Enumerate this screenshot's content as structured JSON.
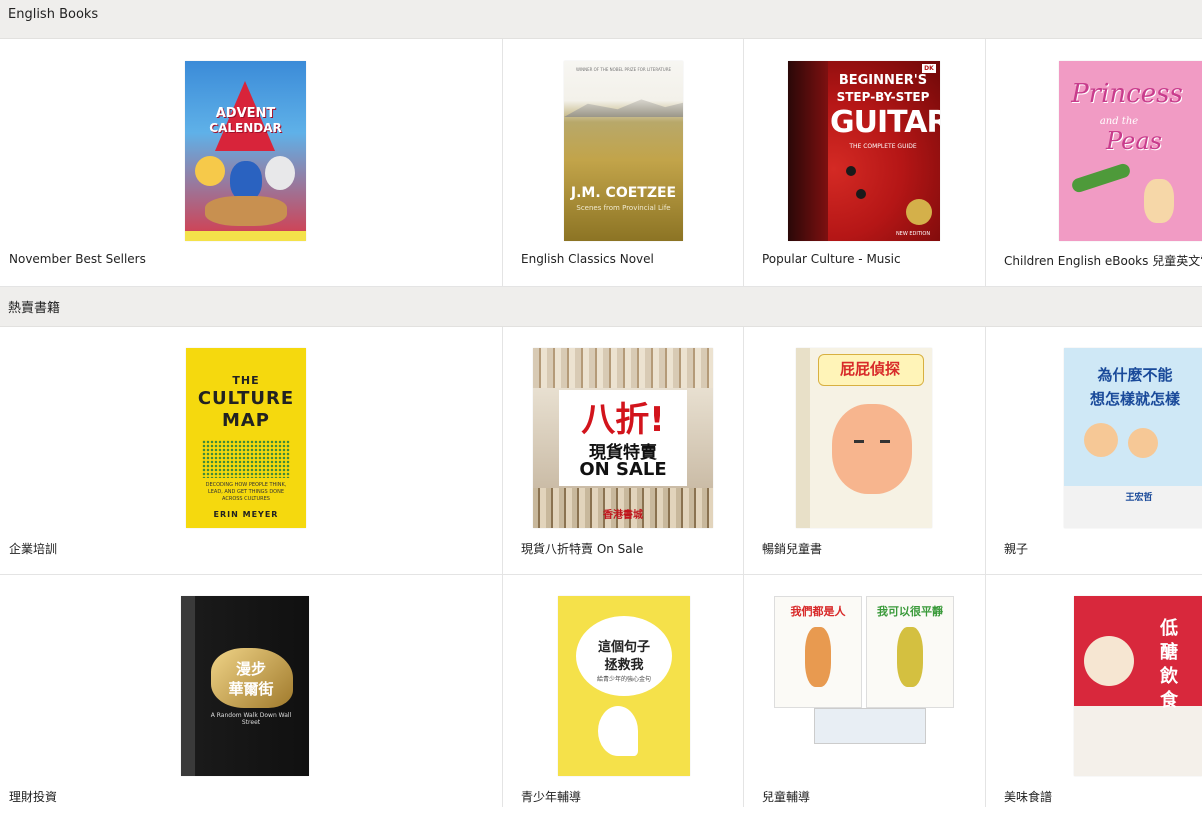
{
  "sections": [
    {
      "title": "English Books",
      "items": [
        {
          "label": "November Best Sellers"
        },
        {
          "label": "English Classics Novel"
        },
        {
          "label": "Popular Culture - Music"
        },
        {
          "label": "Children English eBooks 兒童英文電子"
        }
      ]
    },
    {
      "title": "熱賣書籍",
      "items": [
        {
          "label": "企業培訓"
        },
        {
          "label": "現貨八折特賣 On Sale"
        },
        {
          "label": "暢銷兒童書"
        },
        {
          "label": "親子"
        }
      ]
    },
    {
      "title": "",
      "items": [
        {
          "label": "理財投資"
        },
        {
          "label": "青少年輔導"
        },
        {
          "label": "兒童輔導"
        },
        {
          "label": "美味食譜"
        }
      ]
    }
  ],
  "covers": {
    "advent": {
      "line1": "ADVENT",
      "line2": "CALENDAR"
    },
    "coetzee": {
      "author": "J.M. COETZEE",
      "sub": "Scenes from Provincial Life",
      "top": "WINNER OF THE NOBEL PRIZE FOR LITERATURE"
    },
    "guitar": {
      "l1": "BEGINNER'S",
      "l2": "STEP-BY-STEP",
      "l3": "GUITAR",
      "l4": "THE COMPLETE GUIDE",
      "l5": "NEW EDITION",
      "brand": "DK"
    },
    "princess": {
      "l1": "Princess",
      "l2": "and the",
      "l3": "Peas"
    },
    "culture": {
      "l1": "THE",
      "l2": "CULTURE",
      "l3": "MAP",
      "l4": "DECODING HOW PEOPLE THINK, LEAD, AND GET THINGS DONE ACROSS CULTURES",
      "author": "ERIN MEYER"
    },
    "sale": {
      "l1": "八折!",
      "l2": "現貨特賣",
      "l3": "ON SALE",
      "brand": "香港書城"
    },
    "butt": {
      "title": "屁屁偵探"
    },
    "parent": {
      "l1": "為什麼不能",
      "l2": "想怎樣就怎樣",
      "name": "王宏哲"
    },
    "wallst": {
      "l1": "漫步",
      "l2": "華爾街",
      "sub": "A Random Walk Down Wall Street"
    },
    "youth": {
      "l1": "這個句子",
      "l2": "拯救我",
      "l3": "給青少年的強心金句"
    },
    "kids": {
      "l1": "我們都是人",
      "l2": "我可以很平靜"
    },
    "food": {
      "l1": "低",
      "l2": "醣",
      "l3": "飲",
      "l4": "食"
    }
  }
}
